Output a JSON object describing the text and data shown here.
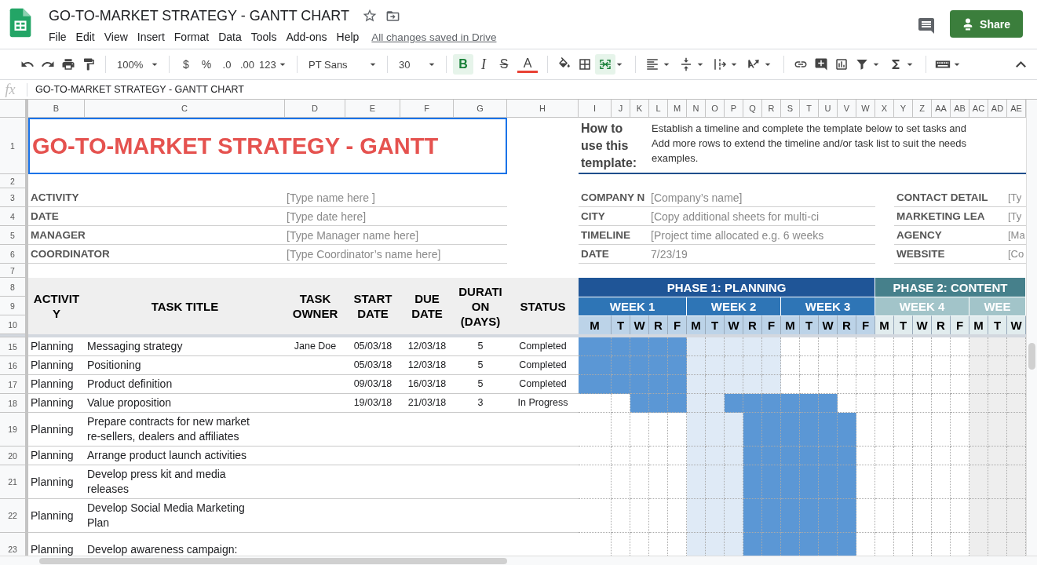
{
  "app": {
    "title": "GO-TO-MARKET STRATEGY - GANTT CHART",
    "menu": [
      "File",
      "Edit",
      "View",
      "Insert",
      "Format",
      "Data",
      "Tools",
      "Add-ons",
      "Help"
    ],
    "save_status": "All changes saved in Drive",
    "share": "Share"
  },
  "toolbar": {
    "zoom": "100%",
    "currency": "$",
    "percent": "%",
    "decrease_decimals": ".0",
    "increase_decimals": ".00",
    "number_format": "123",
    "font": "PT Sans",
    "font_size": "30",
    "bold_label": "B",
    "italic_label": "I",
    "strike_label": "S",
    "text_color_label": "A",
    "bold": true,
    "merge": true
  },
  "formula_bar": {
    "label": "fx",
    "value": "GO-TO-MARKET STRATEGY - GANTT CHART"
  },
  "columns": [
    "B",
    "C",
    "D",
    "E",
    "F",
    "G",
    "H",
    "I",
    "J",
    "K",
    "L",
    "M",
    "N",
    "O",
    "P",
    "Q",
    "R",
    "S",
    "T",
    "U",
    "V",
    "W",
    "X",
    "Y",
    "Z",
    "AA",
    "AB",
    "AC",
    "AD",
    "AE"
  ],
  "row_numbers": [
    "1",
    "2",
    "3",
    "4",
    "5",
    "6",
    "7",
    "8",
    "9",
    "10",
    "15",
    "16",
    "17",
    "18",
    "19",
    "20",
    "21",
    "22",
    "23"
  ],
  "title_row": {
    "title": "GO-TO-MARKET STRATEGY - GANTT",
    "selected": true,
    "help_label": "How to use this template:",
    "help_lines": [
      "Establish a timeline and complete the template below to set tasks and",
      "Add more rows to extend the timeline and/or task list to suit the needs",
      "examples."
    ]
  },
  "project_info": [
    {
      "rows": [
        {
          "label": "ACTIVITY",
          "value": "[Type name here ]"
        },
        {
          "label": "DATE",
          "value": "[Type date here]"
        },
        {
          "label": "MANAGER",
          "value": "[Type Manager name here]"
        },
        {
          "label": "COORDINATOR",
          "value": "[Type Coordinator’s name here]"
        }
      ]
    },
    {
      "rows": [
        {
          "label": "COMPANY N",
          "value": "[Company’s name]"
        },
        {
          "label": "CITY",
          "value": "[Copy additional sheets for multi-ci"
        },
        {
          "label": "TIMELINE",
          "value": "[Project time allocated e.g. 6 weeks"
        },
        {
          "label": "DATE",
          "value": "7/23/19"
        }
      ]
    },
    {
      "rows": [
        {
          "label": "CONTACT DETAIL",
          "value": "[Ty"
        },
        {
          "label": "MARKETING LEA",
          "value": "[Ty"
        },
        {
          "label": "AGENCY",
          "value": "[Ma"
        },
        {
          "label": "WEBSITE",
          "value": "[Co"
        }
      ]
    }
  ],
  "table": {
    "columns": [
      "ACTIVITY",
      "TASK TITLE",
      "TASK OWNER",
      "START DATE",
      "DUE DATE",
      "DURATION (DAYS)",
      "STATUS"
    ],
    "phases": [
      {
        "label": "PHASE 1: PLANNING",
        "color": "#1f5597",
        "weeks": [
          {
            "label": "WEEK 1",
            "color": "#2e75b6",
            "kind": "plain",
            "days": [
              "M",
              "T",
              "W",
              "R",
              "F"
            ]
          },
          {
            "label": "WEEK 2",
            "color": "#2e75b6",
            "kind": "highlight",
            "days": [
              "M",
              "T",
              "W",
              "R",
              "F"
            ]
          },
          {
            "label": "WEEK 3",
            "color": "#2e75b6",
            "kind": "plain",
            "days": [
              "M",
              "T",
              "W",
              "R",
              "F"
            ]
          }
        ]
      },
      {
        "label": "PHASE 2: CONTENT",
        "color": "#46808b",
        "weeks": [
          {
            "label": "WEEK 4",
            "color": "#a2c4c9",
            "kind": "plain",
            "days": [
              "M",
              "T",
              "W",
              "R",
              "F"
            ]
          },
          {
            "label": "WEE",
            "color": "#a2c4c9",
            "kind": "greyed",
            "days": [
              "M",
              "T",
              "W"
            ]
          }
        ]
      }
    ],
    "tasks": [
      {
        "activity": "Planning",
        "title": "Messaging strategy",
        "owner": "Jane Doe",
        "start": "05/03/18",
        "due": "12/03/18",
        "duration": "5",
        "status": "Completed",
        "days": [
          true,
          true,
          true,
          true,
          true,
          false,
          false,
          false,
          false,
          false,
          false,
          false,
          false,
          false,
          false,
          false,
          false,
          false,
          false,
          false,
          false,
          false,
          false
        ]
      },
      {
        "activity": "Planning",
        "title": "Positioning",
        "start": "05/03/18",
        "due": "12/03/18",
        "duration": "5",
        "status": "Completed",
        "days": [
          true,
          true,
          true,
          true,
          true,
          false,
          false,
          false,
          false,
          false,
          false,
          false,
          false,
          false,
          false,
          false,
          false,
          false,
          false,
          false,
          false,
          false,
          false
        ]
      },
      {
        "activity": "Planning",
        "title": "Product definition",
        "start": "09/03/18",
        "due": "16/03/18",
        "duration": "5",
        "status": "Completed",
        "days": [
          true,
          true,
          true,
          true,
          true,
          false,
          false,
          false,
          false,
          false,
          false,
          false,
          false,
          false,
          false,
          false,
          false,
          false,
          false,
          false,
          false,
          false,
          false
        ]
      },
      {
        "activity": "Planning",
        "title": "Value proposition",
        "start": "19/03/18",
        "due": "21/03/18",
        "duration": "3",
        "status": "In Progress",
        "days": [
          false,
          false,
          true,
          true,
          true,
          false,
          false,
          true,
          true,
          true,
          true,
          true,
          true,
          false,
          false,
          false,
          false,
          false,
          false,
          false,
          false,
          false,
          false
        ]
      },
      {
        "activity": "Planning",
        "title": "Prepare contracts for new market re-sellers, dealers and affiliates",
        "days": [
          false,
          false,
          false,
          false,
          false,
          false,
          false,
          false,
          true,
          true,
          true,
          true,
          true,
          true,
          false,
          false,
          false,
          false,
          false,
          false,
          false,
          false,
          false
        ]
      },
      {
        "activity": "Planning",
        "title": "Arrange product launch activities",
        "days": [
          false,
          false,
          false,
          false,
          false,
          false,
          false,
          false,
          true,
          true,
          true,
          true,
          true,
          true,
          false,
          false,
          false,
          false,
          false,
          false,
          false,
          false,
          false
        ]
      },
      {
        "activity": "Planning",
        "title": "Develop press kit and media releases",
        "days": [
          false,
          false,
          false,
          false,
          false,
          false,
          false,
          false,
          true,
          true,
          true,
          true,
          true,
          true,
          false,
          false,
          false,
          false,
          false,
          false,
          false,
          false,
          false
        ]
      },
      {
        "activity": "Planning",
        "title": "Develop Social Media Marketing Plan",
        "days": [
          false,
          false,
          false,
          false,
          false,
          false,
          false,
          false,
          true,
          true,
          true,
          true,
          true,
          true,
          false,
          false,
          false,
          false,
          false,
          false,
          false,
          false,
          false
        ]
      },
      {
        "activity": "Planning",
        "title": "Develop awareness campaign:",
        "days": [
          false,
          false,
          false,
          false,
          false,
          false,
          false,
          false,
          true,
          true,
          true,
          true,
          true,
          true,
          false,
          false,
          false,
          false,
          false,
          false,
          false,
          false,
          false
        ]
      }
    ]
  }
}
